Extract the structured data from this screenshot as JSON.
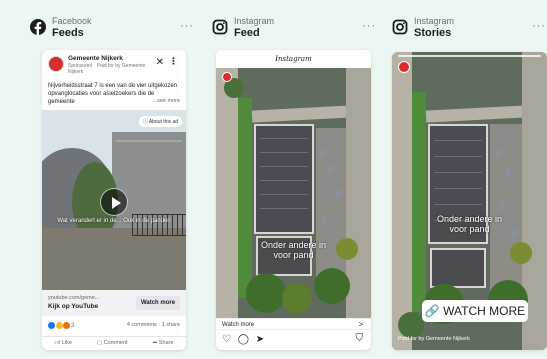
{
  "columns": [
    {
      "platform": "Facebook",
      "placement": "Feeds"
    },
    {
      "platform": "Instagram",
      "placement": "Feed"
    },
    {
      "platform": "Instagram",
      "placement": "Stories"
    }
  ],
  "menu_dots": "···",
  "facebook": {
    "page_name": "Gemeente Nijkerk",
    "sponsored": "Sponsored · Paid for by Gemeente Nijkerk",
    "primary_text": "Nijverheidsstraat 7 is een van de vier uitgekozen opvanglocaties voor asielzoekers die de gemeente",
    "see_more": "...see more",
    "about_ad": "About this ad",
    "video_overlay": "Wat verandert er in de... Ook in de panden",
    "link_domain": "youtube.com/geme...",
    "link_title": "Kijk op YouTube",
    "cta": "Watch more",
    "reactions_count": "3",
    "stats": "4 comments · 1 share",
    "actions": [
      "Like",
      "Comment",
      "Share"
    ]
  },
  "instagram_feed": {
    "logo": "Instagram",
    "overlay": [
      "Onder andere in",
      "voor pand"
    ],
    "cta": "Watch more",
    "cta_arrow": ">",
    "actions": "♡ ◯ ➤",
    "save": "⛉"
  },
  "instagram_stories": {
    "overlay": [
      "Onder andere in",
      "voor pand"
    ],
    "cta": "🔗 WATCH MORE",
    "paid_for": "Paid for by Gemeente Nijkerk"
  },
  "colors": {
    "background": "#ecf6f2",
    "facebook_blue": "#1877f2",
    "instagram": "#222222"
  }
}
